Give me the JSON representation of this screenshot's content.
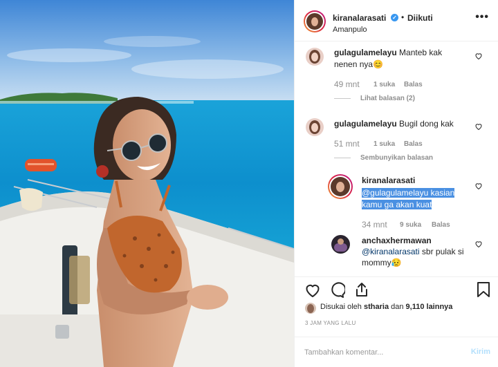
{
  "header": {
    "username": "kiranalarasati",
    "verified_mark": "✓",
    "separator": "•",
    "follow_status": "Diikuti",
    "location": "Amanpulo",
    "more_label": "•••"
  },
  "comments": [
    {
      "username": "gulagulamelayu",
      "text_line1": "Manteb kak",
      "text_line2": "nenen nya",
      "emoji": "😊",
      "time": "49 mnt",
      "likes": "1 suka",
      "reply_label": "Balas",
      "replies_toggle": "Lihat balasan (2)"
    },
    {
      "username": "gulagulamelayu",
      "text": "Bugil dong kak",
      "time": "51 mnt",
      "likes": "1 suka",
      "reply_label": "Balas",
      "replies_toggle": "Sembunyikan balasan",
      "replies": [
        {
          "username": "kiranalarasati",
          "mention": "@gulagulamelayu kasian",
          "text_line2": "kamu ga akan kuat",
          "time": "34 mnt",
          "likes": "9 suka",
          "reply_label": "Balas"
        },
        {
          "username": "anchaxhermawan",
          "mention": "@kiranalarasati",
          "text_rest": " sbr pulak si",
          "text_line2": "mommy",
          "emoji": "😥"
        }
      ]
    }
  ],
  "likes": {
    "prefix": "Disukai oleh ",
    "user": "stharia",
    "middle": " dan ",
    "count": "9,110 lainnya"
  },
  "timestamp": "3 JAM YANG LALU",
  "add_comment": {
    "placeholder": "Tambahkan komentar...",
    "post_label": "Kirim"
  },
  "icons": {
    "like": "heart-icon",
    "comment": "comment-icon",
    "share": "share-icon",
    "save": "bookmark-icon"
  },
  "colors": {
    "verified": "#3897f0",
    "mention_highlight": "#4a90e2",
    "meta_gray": "#8e8e8e",
    "post_disabled": "#b2dffc"
  }
}
